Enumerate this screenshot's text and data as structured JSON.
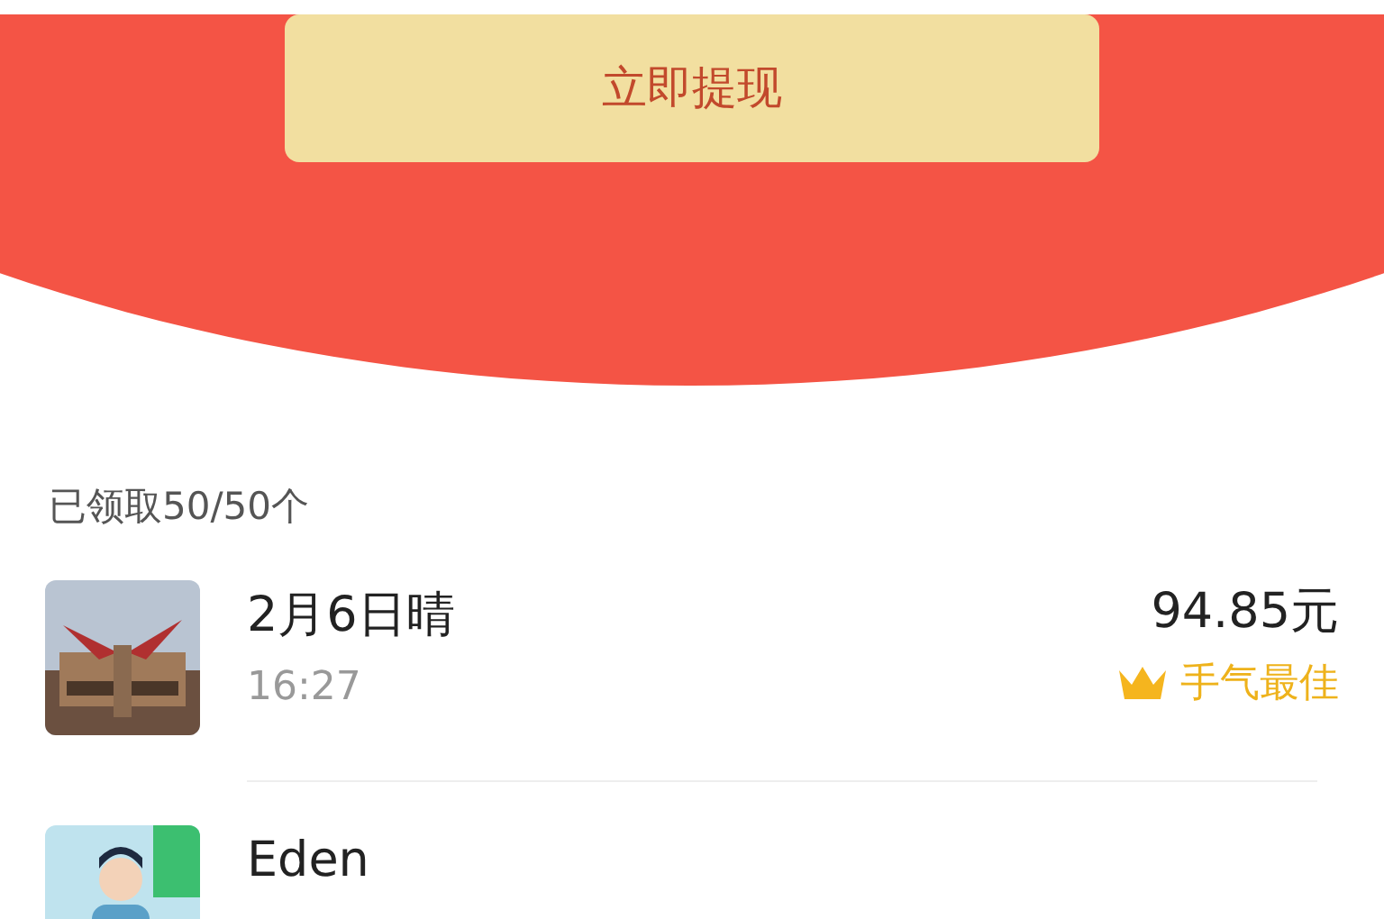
{
  "header": {
    "button": "立即提现"
  },
  "summary": "已领取50/50个",
  "records": [
    {
      "name": "2月6日晴",
      "time": "16:27",
      "amount": "94.85元",
      "badge": "手气最佳"
    },
    {
      "name": "Eden"
    }
  ]
}
